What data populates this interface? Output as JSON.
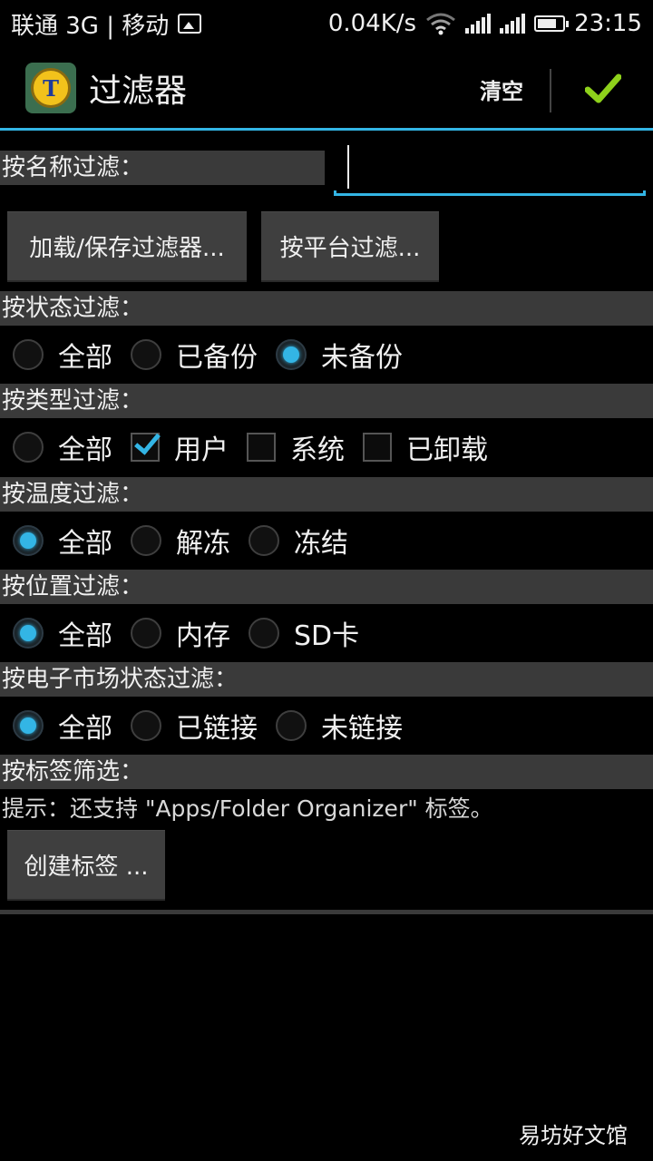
{
  "status_bar": {
    "carrier": "联通 3G | 移动",
    "speed": "0.04K/s",
    "time": "23:15"
  },
  "action_bar": {
    "title": "过滤器",
    "clear_label": "清空"
  },
  "name_filter": {
    "label": "按名称过滤：",
    "value": ""
  },
  "buttons": {
    "load_save": "加载/保存过滤器...",
    "platform": "按平台过滤..."
  },
  "status_filter": {
    "label": "按状态过滤：",
    "options": [
      {
        "label": "全部",
        "checked": false
      },
      {
        "label": "已备份",
        "checked": false
      },
      {
        "label": "未备份",
        "checked": true
      }
    ]
  },
  "type_filter": {
    "label": "按类型过滤：",
    "options": [
      {
        "label": "全部",
        "checked": false,
        "kind": "radio"
      },
      {
        "label": "用户",
        "checked": true,
        "kind": "checkbox"
      },
      {
        "label": "系统",
        "checked": false,
        "kind": "checkbox"
      },
      {
        "label": "已卸载",
        "checked": false,
        "kind": "checkbox"
      }
    ]
  },
  "temperature_filter": {
    "label": "按温度过滤：",
    "options": [
      {
        "label": "全部",
        "checked": true
      },
      {
        "label": "解冻",
        "checked": false
      },
      {
        "label": "冻结",
        "checked": false
      }
    ]
  },
  "location_filter": {
    "label": "按位置过滤：",
    "options": [
      {
        "label": "全部",
        "checked": true
      },
      {
        "label": "内存",
        "checked": false
      },
      {
        "label": "SD卡",
        "checked": false
      }
    ]
  },
  "market_filter": {
    "label": "按电子市场状态过滤：",
    "options": [
      {
        "label": "全部",
        "checked": true
      },
      {
        "label": "已链接",
        "checked": false
      },
      {
        "label": "未链接",
        "checked": false
      }
    ]
  },
  "tag_filter": {
    "label": "按标签筛选：",
    "hint": "提示：还支持 \"Apps/Folder Organizer\" 标签。",
    "create_button": "创建标签 ..."
  },
  "watermark": "易坊好文馆",
  "colors": {
    "accent": "#33b5e5",
    "confirm": "#8ed11b",
    "section_bg": "#3a3a3a",
    "button_bg": "#3f3f3f"
  }
}
